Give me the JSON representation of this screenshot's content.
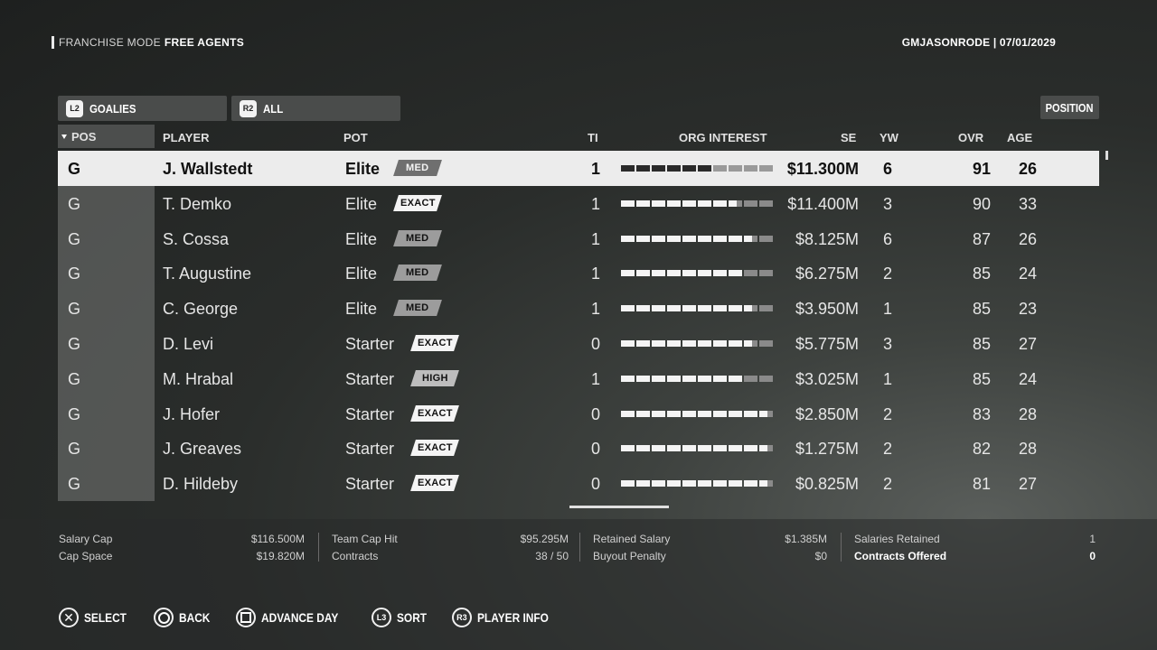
{
  "header": {
    "mode": "FRANCHISE MODE",
    "screen": "FREE AGENTS",
    "user_date": "GMJASONRODE | 07/01/2029"
  },
  "filters": [
    {
      "button": "L2",
      "label": "GOALIES"
    },
    {
      "button": "R2",
      "label": "ALL"
    }
  ],
  "position_button": "POSITION",
  "columns": {
    "pos": "POS",
    "player": "PLAYER",
    "pot": "POT",
    "ti": "TI",
    "org_interest": "ORG INTEREST",
    "se": "SE",
    "yw": "YW",
    "ovr": "OVR",
    "age": "AGE"
  },
  "rows": [
    {
      "pos": "G",
      "player": "J. Wallstedt",
      "pot": "Elite",
      "tag": "MED",
      "ti": "1",
      "interest": 6,
      "se": "$11.300M",
      "yw": "6",
      "ovr": "91",
      "age": "26"
    },
    {
      "pos": "G",
      "player": "T. Demko",
      "pot": "Elite",
      "tag": "EXACT",
      "ti": "1",
      "interest": 7.5,
      "se": "$11.400M",
      "yw": "3",
      "ovr": "90",
      "age": "33"
    },
    {
      "pos": "G",
      "player": "S. Cossa",
      "pot": "Elite",
      "tag": "MED",
      "ti": "1",
      "interest": 8.5,
      "se": "$8.125M",
      "yw": "6",
      "ovr": "87",
      "age": "26"
    },
    {
      "pos": "G",
      "player": "T. Augustine",
      "pot": "Elite",
      "tag": "MED",
      "ti": "1",
      "interest": 8,
      "se": "$6.275M",
      "yw": "2",
      "ovr": "85",
      "age": "24"
    },
    {
      "pos": "G",
      "player": "C. George",
      "pot": "Elite",
      "tag": "MED",
      "ti": "1",
      "interest": 8.5,
      "se": "$3.950M",
      "yw": "1",
      "ovr": "85",
      "age": "23"
    },
    {
      "pos": "G",
      "player": "D. Levi",
      "pot": "Starter",
      "tag": "EXACT",
      "ti": "0",
      "interest": 8.5,
      "se": "$5.775M",
      "yw": "3",
      "ovr": "85",
      "age": "27"
    },
    {
      "pos": "G",
      "player": "M. Hrabal",
      "pot": "Starter",
      "tag": "HIGH",
      "ti": "1",
      "interest": 8,
      "se": "$3.025M",
      "yw": "1",
      "ovr": "85",
      "age": "24"
    },
    {
      "pos": "G",
      "player": "J. Hofer",
      "pot": "Starter",
      "tag": "EXACT",
      "ti": "0",
      "interest": 9.5,
      "se": "$2.850M",
      "yw": "2",
      "ovr": "83",
      "age": "28"
    },
    {
      "pos": "G",
      "player": "J. Greaves",
      "pot": "Starter",
      "tag": "EXACT",
      "ti": "0",
      "interest": 9.5,
      "se": "$1.275M",
      "yw": "2",
      "ovr": "82",
      "age": "28"
    },
    {
      "pos": "G",
      "player": "D. Hildeby",
      "pot": "Starter",
      "tag": "EXACT",
      "ti": "0",
      "interest": 9.5,
      "se": "$0.825M",
      "yw": "2",
      "ovr": "81",
      "age": "27"
    }
  ],
  "footer": {
    "salary_cap_label": "Salary Cap",
    "salary_cap": "$116.500M",
    "cap_space_label": "Cap Space",
    "cap_space": "$19.820M",
    "team_cap_hit_label": "Team Cap Hit",
    "team_cap_hit": "$95.295M",
    "contracts_label": "Contracts",
    "contracts": "38 / 50",
    "retained_salary_label": "Retained Salary",
    "retained_salary": "$1.385M",
    "buyout_penalty_label": "Buyout Penalty",
    "buyout_penalty": "$0",
    "salaries_retained_label": "Salaries Retained",
    "salaries_retained": "1",
    "contracts_offered_label": "Contracts Offered",
    "contracts_offered": "0"
  },
  "prompts": [
    {
      "button": "cross",
      "label": "SELECT"
    },
    {
      "button": "circle",
      "label": "BACK"
    },
    {
      "button": "square",
      "label": "ADVANCE DAY"
    },
    {
      "button": "L3",
      "label": "SORT"
    },
    {
      "button": "R3",
      "label": "PLAYER INFO"
    }
  ]
}
